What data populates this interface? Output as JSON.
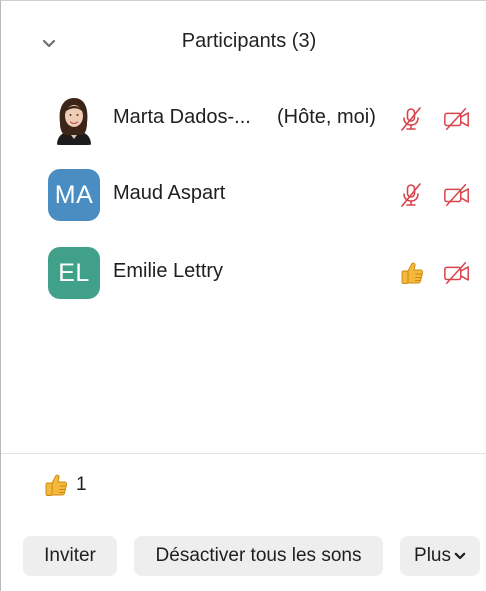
{
  "panel": {
    "title": "Participants (3)"
  },
  "participants": [
    {
      "initials": "",
      "name": "Marta Dados-...",
      "role": "(Hôte, moi)",
      "avatar_type": "photo",
      "status": [
        "mic-muted-icon",
        "video-off-icon"
      ]
    },
    {
      "initials": "MA",
      "name": "Maud Aspart",
      "role": "",
      "avatar_type": "initials",
      "avatar_color": "#4a8dc2",
      "status": [
        "mic-muted-icon",
        "video-off-icon"
      ]
    },
    {
      "initials": "EL",
      "name": "Emilie Lettry",
      "role": "",
      "avatar_type": "initials",
      "avatar_color": "#41a08a",
      "status": [
        "thumbs-up-icon",
        "video-off-icon"
      ]
    }
  ],
  "reactions": {
    "count": "1",
    "icon": "thumbs-up-icon"
  },
  "footer": {
    "invite_label": "Inviter",
    "mute_all_label": "Désactiver tous les sons",
    "more_label": "Plus"
  },
  "colors": {
    "muted_red": "#d9434b",
    "thumb_yellow": "#f4b83a"
  }
}
